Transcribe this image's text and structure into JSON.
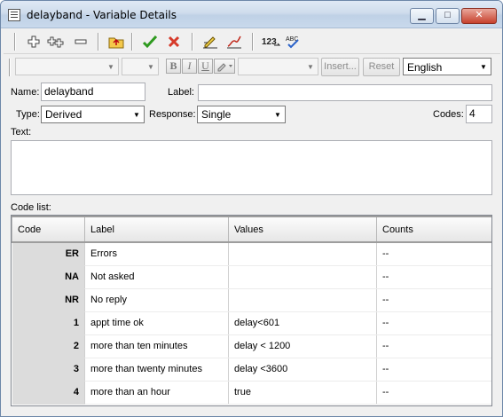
{
  "window": {
    "title": "delayband - Variable Details",
    "minimize": "▁",
    "maximize": "□",
    "close": "✕"
  },
  "toolbar": {
    "icons": [
      "add-icon",
      "add-multiple-icon",
      "remove-icon",
      "folder-up-icon",
      "accept-icon",
      "cancel-icon",
      "edit-icon",
      "draw-icon",
      "numbering-icon",
      "spellcheck-icon"
    ],
    "numbering_glyph": "123",
    "spellcheck_glyph": "ABC"
  },
  "format_bar": {
    "bold": "B",
    "italic": "I",
    "underline": "U",
    "insert_label": "Insert...",
    "reset_label": "Reset",
    "language": "English"
  },
  "form": {
    "name_label": "Name:",
    "name_value": "delayband",
    "label_label": "Label:",
    "label_value": "",
    "type_label": "Type:",
    "type_value": "Derived",
    "response_label": "Response:",
    "response_value": "Single",
    "codes_label": "Codes:",
    "codes_value": "4",
    "text_label": "Text:"
  },
  "code_list": {
    "title": "Code list:",
    "columns": [
      "Code",
      "Label",
      "Values",
      "Counts"
    ],
    "rows": [
      {
        "code": "ER",
        "label": "Errors",
        "values": "",
        "counts": "--"
      },
      {
        "code": "NA",
        "label": "Not asked",
        "values": "",
        "counts": "--"
      },
      {
        "code": "NR",
        "label": "No reply",
        "values": "",
        "counts": "--"
      },
      {
        "code": "1",
        "label": "appt time ok",
        "values": "delay<601",
        "counts": "--"
      },
      {
        "code": "2",
        "label": "more than ten minutes",
        "values": "delay < 1200",
        "counts": "--"
      },
      {
        "code": "3",
        "label": "more than twenty minutes",
        "values": "delay <3600",
        "counts": "--"
      },
      {
        "code": "4",
        "label": "more than an hour",
        "values": "true",
        "counts": "--"
      }
    ]
  },
  "colors": {
    "accept": "#2e9a1f",
    "cancel": "#d63a2a",
    "spellcheck": "#2a62c9"
  }
}
